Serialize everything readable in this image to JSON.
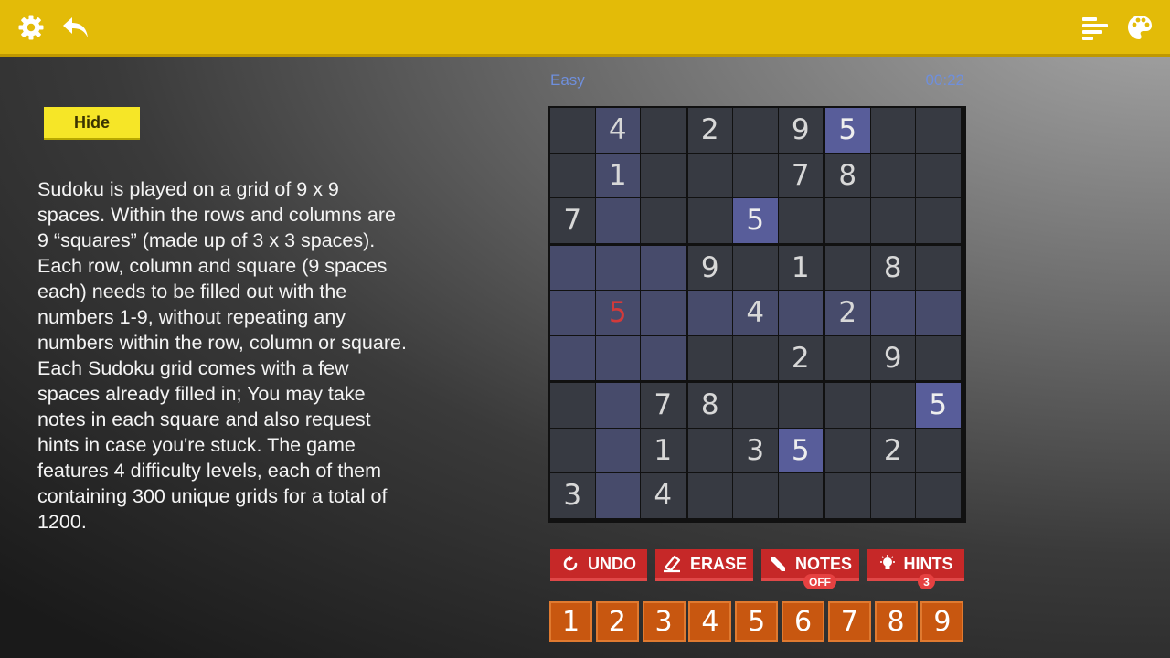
{
  "toolbar": {
    "left_icons": [
      "gear-icon",
      "undo-arrow-icon"
    ],
    "right_icons": [
      "list-icon",
      "palette-icon"
    ],
    "accent_color": "#e3bb08"
  },
  "sidebar": {
    "hide_label": "Hide",
    "description": "Sudoku is played on a grid of 9 x 9\nspaces. Within the rows and columns are\n9 “squares” (made up of 3 x 3 spaces).\nEach row, column and square (9 spaces\neach) needs to be filled out with the\nnumbers 1-9, without repeating any\nnumbers within the row, column or square.\nEach Sudoku grid comes with a few\nspaces already filled in; You may take\nnotes in each square and also request\nhints in case you're stuck. The game\nfeatures 4 difficulty levels, each of them\ncontaining 300 unique grids for a total of\n1200."
  },
  "game": {
    "difficulty": "Easy",
    "timer": "00:22",
    "grid": [
      [
        "",
        "4",
        "",
        "2",
        "",
        "9",
        "5",
        "",
        ""
      ],
      [
        "",
        "1",
        "",
        "",
        "",
        "7",
        "8",
        "",
        ""
      ],
      [
        "7",
        "",
        "",
        "",
        "5",
        "",
        "",
        "",
        ""
      ],
      [
        "",
        "",
        "",
        "9",
        "",
        "1",
        "",
        "8",
        ""
      ],
      [
        "",
        "5",
        "",
        "",
        "4",
        "",
        "2",
        "",
        ""
      ],
      [
        "",
        "",
        "",
        "",
        "",
        "2",
        "",
        "9",
        ""
      ],
      [
        "",
        "",
        "7",
        "8",
        "",
        "",
        "",
        "",
        "5"
      ],
      [
        "",
        "",
        "1",
        "",
        "3",
        "5",
        "",
        "2",
        ""
      ],
      [
        "3",
        "",
        "4",
        "",
        "",
        "",
        "",
        "",
        ""
      ]
    ],
    "selected_cells": [
      [
        0,
        6
      ],
      [
        2,
        4
      ],
      [
        6,
        8
      ],
      [
        7,
        5
      ]
    ],
    "highlighted_cells": [
      [
        0,
        1
      ],
      [
        1,
        1
      ],
      [
        2,
        1
      ],
      [
        3,
        0
      ],
      [
        3,
        1
      ],
      [
        3,
        2
      ],
      [
        4,
        0
      ],
      [
        4,
        1
      ],
      [
        4,
        2
      ],
      [
        4,
        3
      ],
      [
        4,
        4
      ],
      [
        4,
        5
      ],
      [
        4,
        6
      ],
      [
        4,
        7
      ],
      [
        4,
        8
      ],
      [
        5,
        0
      ],
      [
        5,
        1
      ],
      [
        5,
        2
      ],
      [
        6,
        1
      ],
      [
        7,
        1
      ],
      [
        8,
        1
      ]
    ],
    "error_cells": [
      [
        4,
        1
      ]
    ],
    "error_color": "#d33a3a"
  },
  "actions": {
    "undo": "UNDO",
    "erase": "ERASE",
    "notes": "NOTES",
    "notes_state": "OFF",
    "hints": "HINTS",
    "hints_count": "3",
    "button_color": "#c62828"
  },
  "numpad": [
    "1",
    "2",
    "3",
    "4",
    "5",
    "6",
    "7",
    "8",
    "9"
  ]
}
